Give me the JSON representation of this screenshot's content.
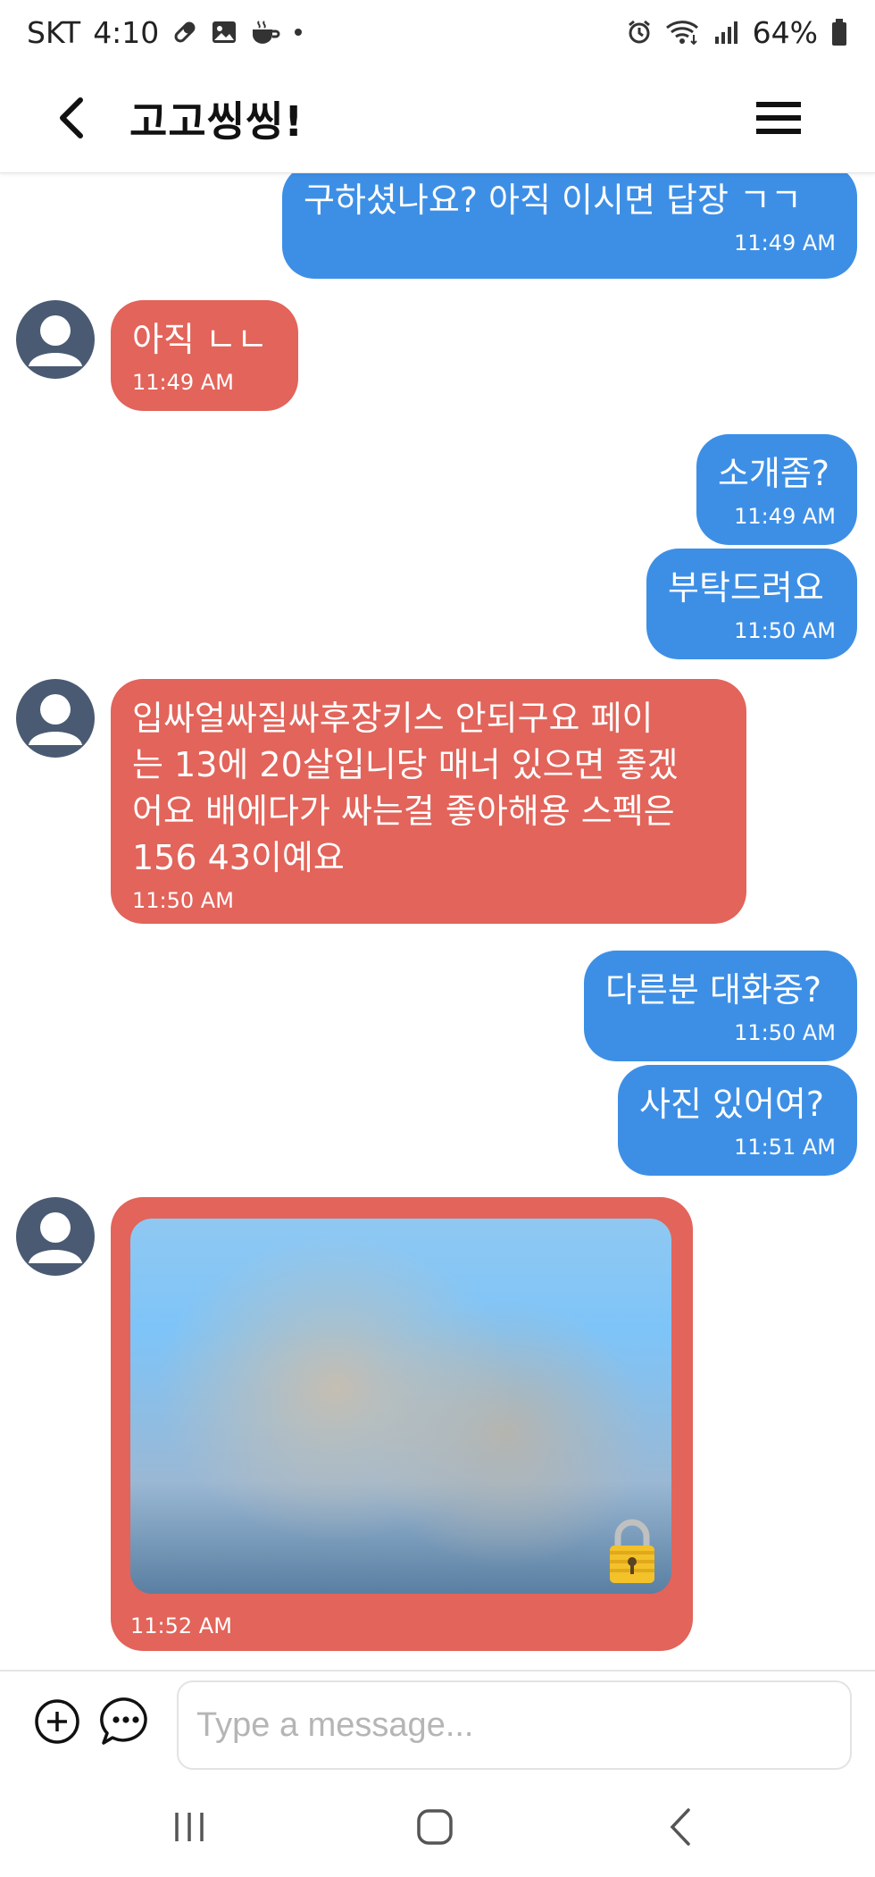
{
  "status_bar": {
    "carrier": "SKT",
    "time": "4:10",
    "battery": "64%",
    "left_icons": [
      "pill-icon",
      "image-icon",
      "teacup-icon",
      "dot-icon"
    ],
    "right_icons": [
      "alarm-icon",
      "wifi-icon",
      "signal-icon",
      "battery-icon"
    ]
  },
  "header": {
    "title": "고고씽씽!"
  },
  "messages": [
    {
      "dir": "out",
      "text": "구하셨나요? 아직 이시면 답장 ㄱㄱ",
      "time": "11:49 AM"
    },
    {
      "dir": "in",
      "text": "아직 ㄴㄴ",
      "time": "11:49 AM"
    },
    {
      "dir": "out",
      "text": "소개좀?",
      "time": "11:49 AM"
    },
    {
      "dir": "out",
      "text": "부탁드려요",
      "time": "11:50 AM"
    },
    {
      "dir": "in",
      "text": "입싸얼싸질싸후장키스 안되구요 페이\n는 13에 20살입니당 매너 있으면 좋겠\n어요 배에다가 싸는걸 좋아해용 스펙은\n156 43이예요",
      "time": "11:50 AM"
    },
    {
      "dir": "out",
      "text": "다른분 대화중?",
      "time": "11:50 AM"
    },
    {
      "dir": "out",
      "text": "사진 있어여?",
      "time": "11:51 AM"
    },
    {
      "dir": "in",
      "type": "locked-photo",
      "time": "11:52 AM"
    }
  ],
  "input": {
    "placeholder": "Type a message..."
  },
  "colors": {
    "outgoing_bubble": "#3d8fe6",
    "incoming_bubble": "#e2645a",
    "avatar": "#4a5a72"
  }
}
